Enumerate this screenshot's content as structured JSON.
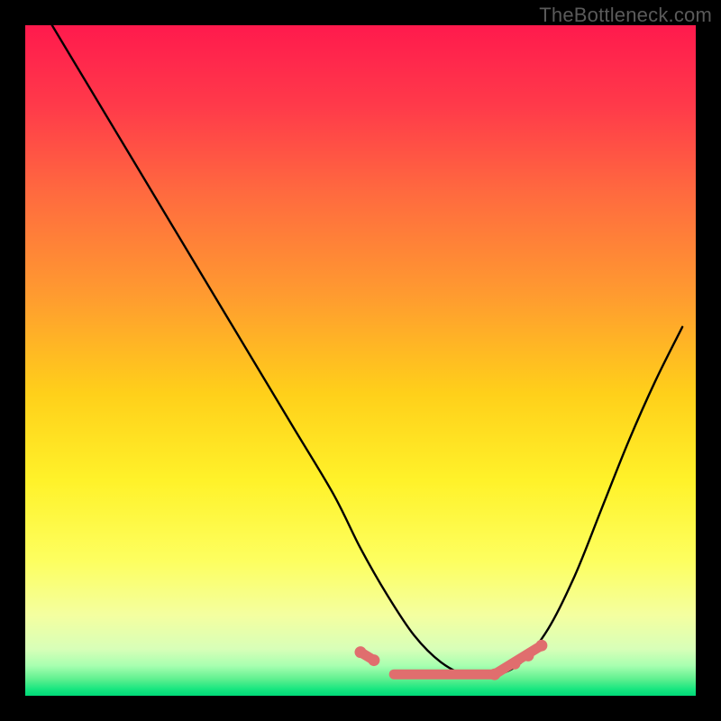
{
  "watermark": "TheBottleneck.com",
  "colors": {
    "page_bg": "#000000",
    "curve_stroke": "#000000",
    "pink_stroke": "#e06e6e",
    "gradient_stops": [
      {
        "offset": 0.0,
        "color": "#ff1a4d"
      },
      {
        "offset": 0.12,
        "color": "#ff3a4a"
      },
      {
        "offset": 0.25,
        "color": "#ff6a3f"
      },
      {
        "offset": 0.4,
        "color": "#ff9a30"
      },
      {
        "offset": 0.55,
        "color": "#ffd01a"
      },
      {
        "offset": 0.68,
        "color": "#fff22a"
      },
      {
        "offset": 0.8,
        "color": "#fdff60"
      },
      {
        "offset": 0.88,
        "color": "#f4ffa0"
      },
      {
        "offset": 0.93,
        "color": "#d8ffb8"
      },
      {
        "offset": 0.955,
        "color": "#a8ffb0"
      },
      {
        "offset": 0.975,
        "color": "#60f090"
      },
      {
        "offset": 0.99,
        "color": "#18e680"
      },
      {
        "offset": 1.0,
        "color": "#00d878"
      }
    ]
  },
  "chart_data": {
    "type": "line",
    "title": "",
    "xlabel": "",
    "ylabel": "",
    "xlim": [
      0,
      100
    ],
    "ylim": [
      0,
      100
    ],
    "note": "Axes unlabeled in source; x is horizontal normalized 0–100, y is vertical normalized 0–100 with 0 at bottom. Curve represents a bottleneck-style metric dipping to a minimum around x≈55–70 then rising.",
    "series": [
      {
        "name": "main-curve",
        "x": [
          4,
          10,
          16,
          22,
          28,
          34,
          40,
          46,
          50,
          54,
          58,
          62,
          66,
          70,
          74,
          78,
          82,
          86,
          90,
          94,
          98
        ],
        "y": [
          100,
          90,
          80,
          70,
          60,
          50,
          40,
          30,
          22,
          15,
          9,
          5,
          3,
          3,
          5,
          10,
          18,
          28,
          38,
          47,
          55
        ]
      }
    ],
    "highlight_segments": [
      {
        "name": "pink-left",
        "x": [
          50,
          52
        ],
        "y": [
          6.5,
          5.3
        ]
      },
      {
        "name": "pink-floor",
        "x": [
          55,
          70
        ],
        "y": [
          3.2,
          3.2
        ]
      },
      {
        "name": "pink-right",
        "x": [
          70,
          77
        ],
        "y": [
          3.2,
          7.5
        ]
      }
    ],
    "highlight_dots": [
      {
        "x": 50,
        "y": 6.5
      },
      {
        "x": 52,
        "y": 5.3
      },
      {
        "x": 70,
        "y": 3.2
      },
      {
        "x": 73,
        "y": 4.8
      },
      {
        "x": 75,
        "y": 6.0
      },
      {
        "x": 77,
        "y": 7.5
      }
    ]
  }
}
